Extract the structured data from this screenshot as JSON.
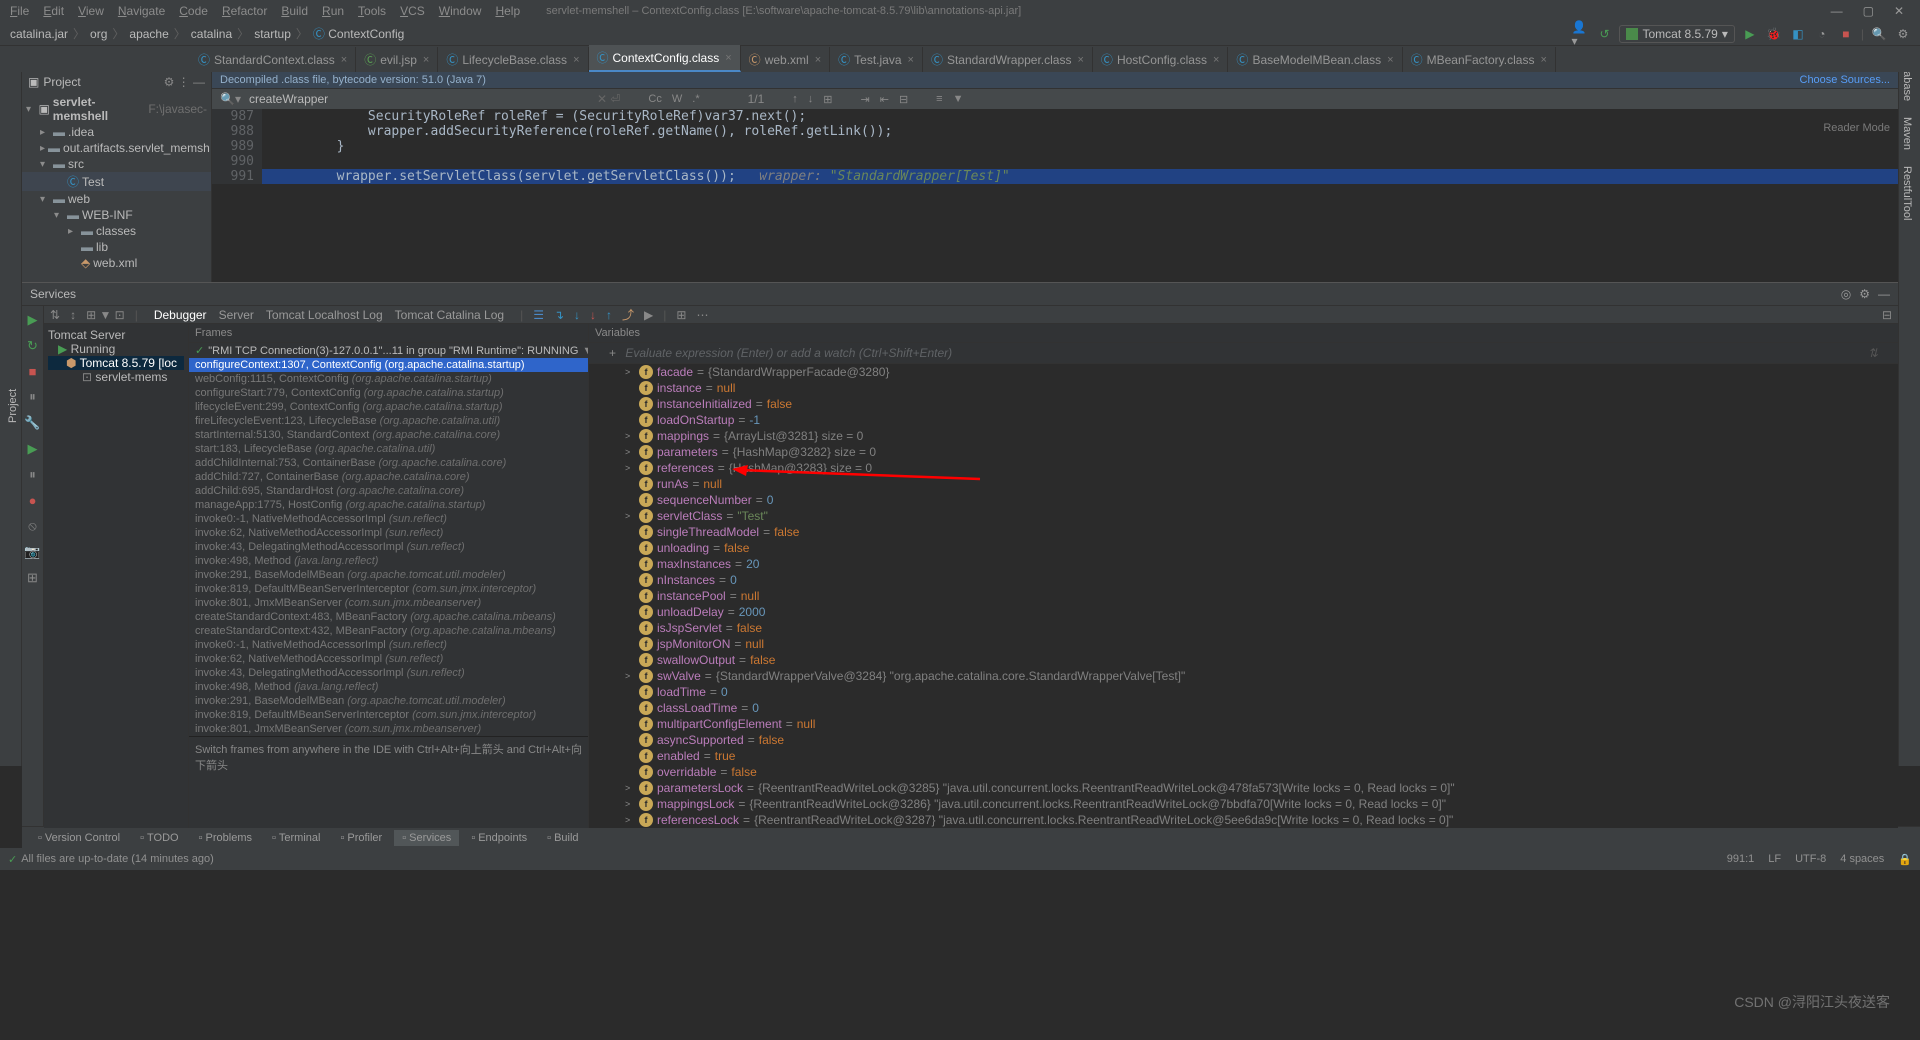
{
  "title_bar": {
    "menus": [
      "File",
      "Edit",
      "View",
      "Navigate",
      "Code",
      "Refactor",
      "Build",
      "Run",
      "Tools",
      "VCS",
      "Window",
      "Help"
    ],
    "title": "servlet-memshell – ContextConfig.class [E:\\software\\apache-tomcat-8.5.79\\lib\\annotations-api.jar]"
  },
  "breadcrumb": [
    "catalina.jar",
    "org",
    "apache",
    "catalina",
    "startup",
    "ContextConfig"
  ],
  "run_config": "Tomcat 8.5.79",
  "project": {
    "header": "Project",
    "root": "servlet-memshell",
    "root_path": "F:\\javasec-",
    "items": [
      {
        "indent": 1,
        "icon": "folder",
        "label": ".idea",
        "arrow": ">"
      },
      {
        "indent": 1,
        "icon": "folder",
        "label": "out.artifacts.servlet_memsh",
        "arrow": ">"
      },
      {
        "indent": 1,
        "icon": "folder-src",
        "label": "src",
        "arrow": "v"
      },
      {
        "indent": 2,
        "icon": "class",
        "label": "Test",
        "arrow": "",
        "sel": true
      },
      {
        "indent": 1,
        "icon": "folder-web",
        "label": "web",
        "arrow": "v"
      },
      {
        "indent": 2,
        "icon": "folder",
        "label": "WEB-INF",
        "arrow": "v"
      },
      {
        "indent": 3,
        "icon": "folder",
        "label": "classes",
        "arrow": ">"
      },
      {
        "indent": 3,
        "icon": "folder",
        "label": "lib",
        "arrow": ""
      },
      {
        "indent": 3,
        "icon": "xml",
        "label": "web.xml",
        "arrow": ""
      }
    ]
  },
  "tabs": [
    {
      "icon": "c-blue",
      "label": "StandardContext.class",
      "active": false
    },
    {
      "icon": "c-green",
      "label": "evil.jsp",
      "active": false
    },
    {
      "icon": "c-blue",
      "label": "LifecycleBase.class",
      "active": false
    },
    {
      "icon": "c-blue",
      "label": "ContextConfig.class",
      "active": true
    },
    {
      "icon": "c-orange",
      "label": "web.xml",
      "active": false
    },
    {
      "icon": "c-blue",
      "label": "Test.java",
      "active": false
    },
    {
      "icon": "c-blue",
      "label": "StandardWrapper.class",
      "active": false
    },
    {
      "icon": "c-blue",
      "label": "HostConfig.class",
      "active": false
    },
    {
      "icon": "c-blue",
      "label": "BaseModelMBean.class",
      "active": false
    },
    {
      "icon": "c-blue",
      "label": "MBeanFactory.class",
      "active": false
    }
  ],
  "editor": {
    "banner": "Decompiled .class file, bytecode version: 51.0 (Java 7)",
    "banner_link": "Choose Sources...",
    "find_text": "createWrapper",
    "position": "1/1",
    "reader_mode": "Reader Mode",
    "lines": [
      {
        "n": 987,
        "html": "            SecurityRoleRef roleRef = (SecurityRoleRef)var37.next();"
      },
      {
        "n": 988,
        "html": "            wrapper.addSecurityReference(roleRef.getName(), roleRef.getLink());"
      },
      {
        "n": 989,
        "html": "        }"
      },
      {
        "n": 990,
        "html": ""
      },
      {
        "n": 991,
        "html": "        wrapper.setServletClass(servlet.getServletClass());   wrapper: \"StandardWrapper[Test]\""
      }
    ]
  },
  "services": {
    "title": "Services",
    "toolbar_tabs": [
      "Debugger",
      "Server",
      "Tomcat Localhost Log",
      "Tomcat Catalina Log"
    ],
    "tree": {
      "root": "Tomcat Server",
      "child1": "Running",
      "child2": "Tomcat 8.5.79 [loc",
      "child3": "servlet-mems"
    }
  },
  "frames": {
    "header": "Frames",
    "top_thread": "\"RMI TCP Connection(3)-127.0.0.1\"...11 in group \"RMI Runtime\": RUNNING",
    "active": "configureContext:1307, ContextConfig (org.apache.catalina.startup)",
    "list": [
      {
        "m": "webConfig:1115, ContextConfig",
        "p": "(org.apache.catalina.startup)"
      },
      {
        "m": "configureStart:779, ContextConfig",
        "p": "(org.apache.catalina.startup)"
      },
      {
        "m": "lifecycleEvent:299, ContextConfig",
        "p": "(org.apache.catalina.startup)"
      },
      {
        "m": "fireLifecycleEvent:123, LifecycleBase",
        "p": "(org.apache.catalina.util)"
      },
      {
        "m": "startInternal:5130, StandardContext",
        "p": "(org.apache.catalina.core)"
      },
      {
        "m": "start:183, LifecycleBase",
        "p": "(org.apache.catalina.util)"
      },
      {
        "m": "addChildInternal:753, ContainerBase",
        "p": "(org.apache.catalina.core)"
      },
      {
        "m": "addChild:727, ContainerBase",
        "p": "(org.apache.catalina.core)"
      },
      {
        "m": "addChild:695, StandardHost",
        "p": "(org.apache.catalina.core)"
      },
      {
        "m": "manageApp:1775, HostConfig",
        "p": "(org.apache.catalina.startup)"
      },
      {
        "m": "invoke0:-1, NativeMethodAccessorImpl",
        "p": "(sun.reflect)"
      },
      {
        "m": "invoke:62, NativeMethodAccessorImpl",
        "p": "(sun.reflect)"
      },
      {
        "m": "invoke:43, DelegatingMethodAccessorImpl",
        "p": "(sun.reflect)"
      },
      {
        "m": "invoke:498, Method",
        "p": "(java.lang.reflect)"
      },
      {
        "m": "invoke:291, BaseModelMBean",
        "p": "(org.apache.tomcat.util.modeler)"
      },
      {
        "m": "invoke:819, DefaultMBeanServerInterceptor",
        "p": "(com.sun.jmx.interceptor)"
      },
      {
        "m": "invoke:801, JmxMBeanServer",
        "p": "(com.sun.jmx.mbeanserver)"
      },
      {
        "m": "createStandardContext:483, MBeanFactory",
        "p": "(org.apache.catalina.mbeans)"
      },
      {
        "m": "createStandardContext:432, MBeanFactory",
        "p": "(org.apache.catalina.mbeans)"
      },
      {
        "m": "invoke0:-1, NativeMethodAccessorImpl",
        "p": "(sun.reflect)"
      },
      {
        "m": "invoke:62, NativeMethodAccessorImpl",
        "p": "(sun.reflect)"
      },
      {
        "m": "invoke:43, DelegatingMethodAccessorImpl",
        "p": "(sun.reflect)"
      },
      {
        "m": "invoke:498, Method",
        "p": "(java.lang.reflect)"
      },
      {
        "m": "invoke:291, BaseModelMBean",
        "p": "(org.apache.tomcat.util.modeler)"
      },
      {
        "m": "invoke:819, DefaultMBeanServerInterceptor",
        "p": "(com.sun.jmx.interceptor)"
      },
      {
        "m": "invoke:801, JmxMBeanServer",
        "p": "(com.sun.jmx.mbeanserver)"
      }
    ],
    "switch_hint": "Switch frames from anywhere in the IDE with Ctrl+Alt+向上箭头 and Ctrl+Alt+向下箭头"
  },
  "variables": {
    "header": "Variables",
    "eval_placeholder": "Evaluate expression (Enter) or add a watch (Ctrl+Shift+Enter)",
    "items": [
      {
        "arrow": ">",
        "icon": "f",
        "name": "facade",
        "val": "{StandardWrapperFacade@3280}",
        "type": "obj"
      },
      {
        "arrow": "",
        "icon": "f",
        "name": "instance",
        "val": "null",
        "type": "null"
      },
      {
        "arrow": "",
        "icon": "f",
        "name": "instanceInitialized",
        "val": "false",
        "type": "null"
      },
      {
        "arrow": "",
        "icon": "f",
        "name": "loadOnStartup",
        "val": "-1",
        "type": "num"
      },
      {
        "arrow": ">",
        "icon": "f",
        "name": "mappings",
        "val": "{ArrayList@3281}  size = 0",
        "type": "obj"
      },
      {
        "arrow": ">",
        "icon": "f",
        "name": "parameters",
        "val": "{HashMap@3282}  size = 0",
        "type": "obj"
      },
      {
        "arrow": ">",
        "icon": "f",
        "name": "references",
        "val": "{HashMap@3283}  size = 0",
        "type": "obj"
      },
      {
        "arrow": "",
        "icon": "f",
        "name": "runAs",
        "val": "null",
        "type": "null"
      },
      {
        "arrow": "",
        "icon": "f",
        "name": "sequenceNumber",
        "val": "0",
        "type": "num"
      },
      {
        "arrow": ">",
        "icon": "f",
        "name": "servletClass",
        "val": "\"Test\"",
        "type": "str",
        "mark": true
      },
      {
        "arrow": "",
        "icon": "f",
        "name": "singleThreadModel",
        "val": "false",
        "type": "null"
      },
      {
        "arrow": "",
        "icon": "f",
        "name": "unloading",
        "val": "false",
        "type": "null"
      },
      {
        "arrow": "",
        "icon": "f",
        "name": "maxInstances",
        "val": "20",
        "type": "num"
      },
      {
        "arrow": "",
        "icon": "f",
        "name": "nInstances",
        "val": "0",
        "type": "num"
      },
      {
        "arrow": "",
        "icon": "f",
        "name": "instancePool",
        "val": "null",
        "type": "null"
      },
      {
        "arrow": "",
        "icon": "f",
        "name": "unloadDelay",
        "val": "2000",
        "type": "num"
      },
      {
        "arrow": "",
        "icon": "f",
        "name": "isJspServlet",
        "val": "false",
        "type": "null"
      },
      {
        "arrow": "",
        "icon": "f",
        "name": "jspMonitorON",
        "val": "null",
        "type": "null"
      },
      {
        "arrow": "",
        "icon": "f",
        "name": "swallowOutput",
        "val": "false",
        "type": "null"
      },
      {
        "arrow": ">",
        "icon": "f",
        "name": "swValve",
        "val": "{StandardWrapperValve@3284} \"org.apache.catalina.core.StandardWrapperValve[Test]\"",
        "type": "obj"
      },
      {
        "arrow": "",
        "icon": "f",
        "name": "loadTime",
        "val": "0",
        "type": "num"
      },
      {
        "arrow": "",
        "icon": "f",
        "name": "classLoadTime",
        "val": "0",
        "type": "num"
      },
      {
        "arrow": "",
        "icon": "f",
        "name": "multipartConfigElement",
        "val": "null",
        "type": "null"
      },
      {
        "arrow": "",
        "icon": "f",
        "name": "asyncSupported",
        "val": "false",
        "type": "null"
      },
      {
        "arrow": "",
        "icon": "f",
        "name": "enabled",
        "val": "true",
        "type": "null"
      },
      {
        "arrow": "",
        "icon": "f",
        "name": "overridable",
        "val": "false",
        "type": "null"
      },
      {
        "arrow": ">",
        "icon": "f",
        "name": "parametersLock",
        "val": "{ReentrantReadWriteLock@3285} \"java.util.concurrent.locks.ReentrantReadWriteLock@478fa573[Write locks = 0, Read locks = 0]\"",
        "type": "obj"
      },
      {
        "arrow": ">",
        "icon": "f",
        "name": "mappingsLock",
        "val": "{ReentrantReadWriteLock@3286} \"java.util.concurrent.locks.ReentrantReadWriteLock@7bbdfa70[Write locks = 0, Read locks = 0]\"",
        "type": "obj"
      },
      {
        "arrow": ">",
        "icon": "f",
        "name": "referencesLock",
        "val": "{ReentrantReadWriteLock@3287} \"java.util.concurrent.locks.ReentrantReadWriteLock@5ee6da9c[Write locks = 0, Read locks = 0]\"",
        "type": "obj"
      }
    ]
  },
  "bottom_tabs": [
    "Version Control",
    "TODO",
    "Problems",
    "Terminal",
    "Profiler",
    "Services",
    "Endpoints",
    "Build"
  ],
  "status": {
    "left": "All files are up-to-date (14 minutes ago)",
    "right": [
      "991:1",
      "LF",
      "UTF-8",
      "4 spaces"
    ]
  },
  "watermark": "CSDN @浔阳江头夜送客"
}
